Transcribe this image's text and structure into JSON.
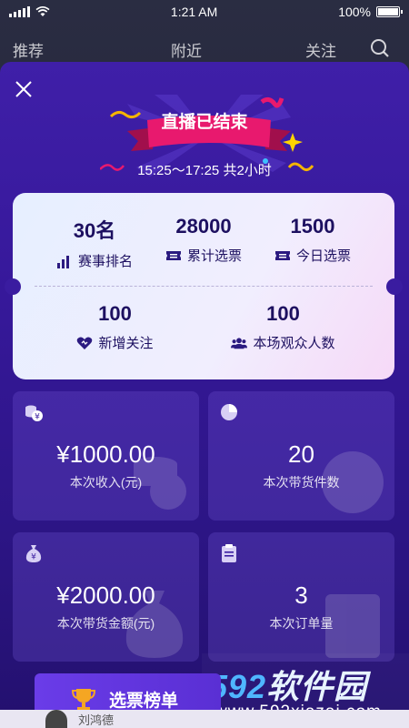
{
  "status_bar": {
    "time": "1:21 AM",
    "battery": "100%"
  },
  "top_nav": {
    "items": [
      "推荐",
      "附近",
      "关注"
    ]
  },
  "banner": {
    "title": "直播已结束",
    "time_range": "15:25～17:25 共2小时"
  },
  "stats_top": [
    {
      "value": "30名",
      "label": "赛事排名",
      "icon": "bar-chart-icon"
    },
    {
      "value": "28000",
      "label": "累计选票",
      "icon": "ticket-icon"
    },
    {
      "value": "1500",
      "label": "今日选票",
      "icon": "ticket-icon"
    }
  ],
  "stats_bottom": [
    {
      "value": "100",
      "label": "新增关注",
      "icon": "heart-icon"
    },
    {
      "value": "100",
      "label": "本场观众人数",
      "icon": "users-icon"
    }
  ],
  "cards": [
    {
      "value": "¥1000.00",
      "label": "本次收入(元)",
      "icon": "coins-icon"
    },
    {
      "value": "20",
      "label": "本次带货件数",
      "icon": "pie-chart-icon"
    },
    {
      "value": "¥2000.00",
      "label": "本次带货金额(元)",
      "icon": "money-bag-icon"
    },
    {
      "value": "3",
      "label": "本次订单量",
      "icon": "clipboard-icon"
    }
  ],
  "vote_button": {
    "label": "选票榜单",
    "icon": "trophy-icon"
  },
  "watermark": {
    "brand": "592软件园",
    "url": "www.592xiazai.com"
  },
  "bottom": {
    "name": "刘鸿德"
  },
  "colors": {
    "panel": "#3a1ca0",
    "accent_pink": "#e8196e",
    "text_dark": "#1d1060"
  }
}
